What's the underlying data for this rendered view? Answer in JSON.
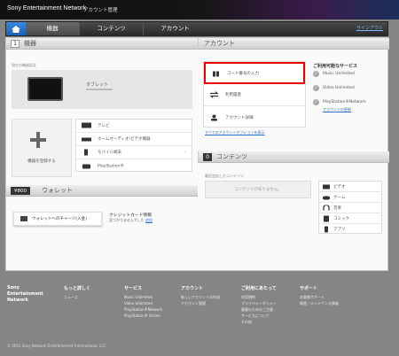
{
  "header": {
    "brand": "Sony Entertainment Network",
    "title": "アカウント管理"
  },
  "nav": {
    "devices": "機器",
    "content": "コンテンツ",
    "account": "アカウント",
    "signout": "サインアウト"
  },
  "devices": {
    "num": "1",
    "title": "機器",
    "registered_label": "現在の機器認証",
    "tablet": "タブレット",
    "add_button": "機器を登録する",
    "types": [
      "テレビ",
      "ホームオーディオ/ビデオ機器",
      "モバイル端末",
      "PlayStation®"
    ]
  },
  "wallet": {
    "amount": "¥800",
    "title": "ウォレット",
    "charge_button": "ウォレットへのチャージ(入金)",
    "card_title": "クレジットカード情報",
    "card_text": "見つかりませんでした",
    "card_link": "追加"
  },
  "account": {
    "title": "アカウント",
    "items": [
      "コード番号の入力",
      "利用履歴",
      "アカウント詳細"
    ],
    "all_options": "すべてのアカウントオプションを表示",
    "services_title": "ご利用可能なサービス",
    "services": [
      "Music Unlimited",
      "Video Unlimited",
      "PlayStation®Network"
    ],
    "account_link": "アカウントの更新"
  },
  "content": {
    "num": "0",
    "title": "コンテンツ",
    "recent_label": "最近追加したコンテンツ",
    "empty": "コンテンツがありません。",
    "types": [
      "ビデオ",
      "ゲーム",
      "音楽",
      "コミック",
      "アプリ"
    ]
  },
  "footer": {
    "brand": "Sony Entertainment Network",
    "cols": [
      {
        "head": "もっと詳しく",
        "items": [
          "ニュース"
        ]
      },
      {
        "head": "サービス",
        "items": [
          "Music Unlimited",
          "Video Unlimited",
          "PlayStation®Network",
          "PlayStation® Online"
        ]
      },
      {
        "head": "アカウント",
        "items": [
          "新しいアカウントの作成",
          "アカウント管理"
        ]
      },
      {
        "head": "ご利用にあたって",
        "items": [
          "利用規約",
          "プライバシーポリシー",
          "健康のためのご注意",
          "サービスについて",
          "その他"
        ]
      },
      {
        "head": "サポート",
        "items": [
          "お客様サポート",
          "障害・メンテナンス情報"
        ]
      }
    ],
    "copyright": "© 2012 Sony Network Entertainment International, LLC"
  }
}
